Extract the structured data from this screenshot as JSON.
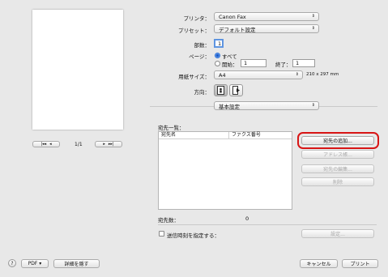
{
  "printer": {
    "label": "プリンタ：",
    "value": "Canon Fax"
  },
  "preset": {
    "label": "プリセット：",
    "value": "デフォルト設定"
  },
  "copies": {
    "label": "部数：",
    "value": "1"
  },
  "pages": {
    "label": "ページ：",
    "all_label": "すべて",
    "from_label": "開始：",
    "from_value": "1",
    "to_label": "終了：",
    "to_value": "1"
  },
  "paper_size": {
    "label": "用紙サイズ：",
    "value": "A4",
    "dims": "210 x 297 mm"
  },
  "orientation": {
    "label": "方向："
  },
  "section": {
    "value": "基本設定"
  },
  "dest_list": {
    "title": "宛先一覧：",
    "col_name": "宛先名",
    "col_fax": "ファクス番号",
    "count_label": "宛先数：",
    "count_value": "0"
  },
  "buttons": {
    "add_dest": "宛先の追加...",
    "address_book": "アドレス帳...",
    "edit_dest": "宛先の編集...",
    "delete": "削除",
    "settings": "設定...",
    "cancel": "キャンセル",
    "print": "プリント",
    "pdf": "PDF ▾",
    "hide_details": "詳細を隠す",
    "help": "?"
  },
  "schedule": {
    "label": "送信時刻を指定する："
  },
  "preview_nav": {
    "page": "1/1",
    "first": "|◂◂",
    "prev": "◂",
    "next": "▸",
    "last": "▸▸|"
  },
  "colors": {
    "highlight": "#d81515",
    "accent": "#2b6fd6"
  }
}
